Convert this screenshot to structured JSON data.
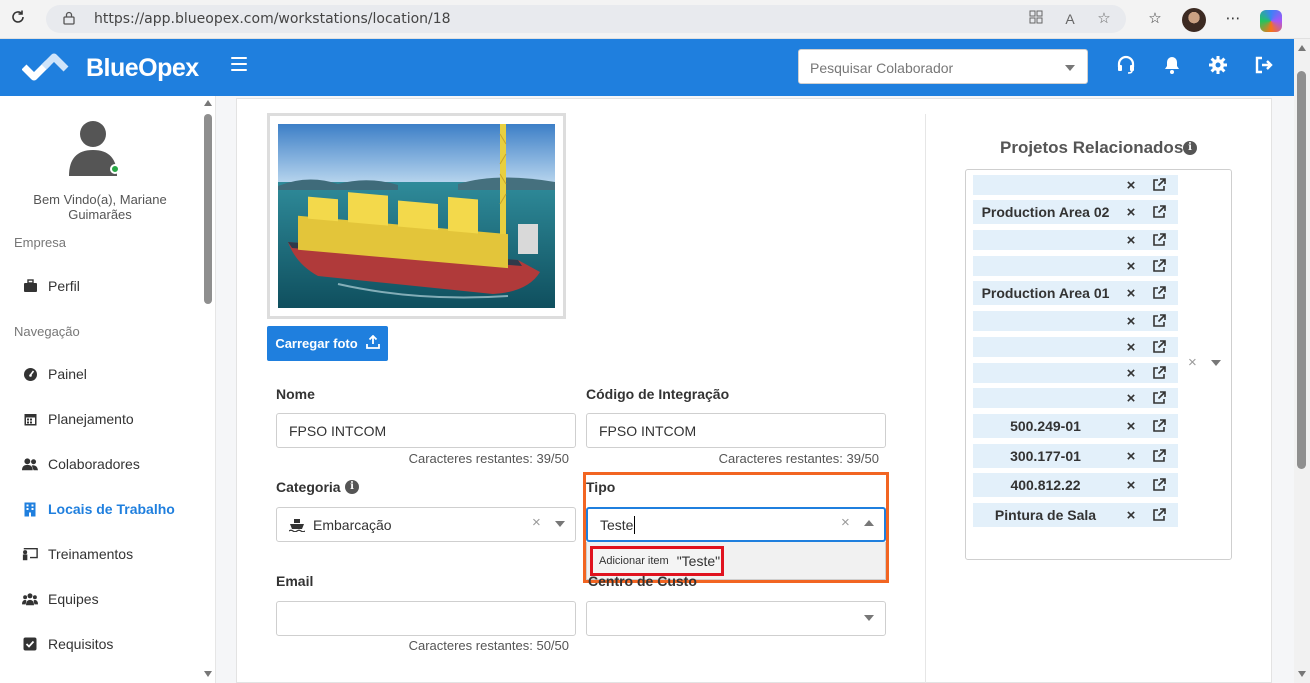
{
  "browser": {
    "url": "https://app.blueopex.com/workstations/location/18"
  },
  "app": {
    "brand": "BlueOpex",
    "search_placeholder": "Pesquisar Colaborador"
  },
  "sidebar": {
    "welcome": "Bem Vindo(a), Mariane Guimarães",
    "section_company": "Empresa",
    "section_nav": "Navegação",
    "items": [
      {
        "label": "Perfil",
        "icon": "briefcase-icon"
      },
      {
        "label": "Painel",
        "icon": "gauge-icon"
      },
      {
        "label": "Planejamento",
        "icon": "calendar-icon"
      },
      {
        "label": "Colaboradores",
        "icon": "users-icon"
      },
      {
        "label": "Locais de Trabalho",
        "icon": "building-icon",
        "active": true
      },
      {
        "label": "Treinamentos",
        "icon": "chalkboard-icon"
      },
      {
        "label": "Equipes",
        "icon": "group-icon"
      },
      {
        "label": "Requisitos",
        "icon": "checkbox-icon"
      }
    ]
  },
  "form": {
    "upload_label": "Carregar foto",
    "nome_label": "Nome",
    "nome_value": "FPSO INTCOM",
    "nome_hint": "Caracteres restantes: 39/50",
    "codigo_label": "Código de Integração",
    "codigo_value": "FPSO INTCOM",
    "codigo_hint": "Caracteres restantes: 39/50",
    "categoria_label": "Categoria",
    "categoria_value": "Embarcação",
    "tipo_label": "Tipo",
    "tipo_value": "Teste",
    "tipo_add_small": "Adicionar item",
    "tipo_add_value": "\"Teste\"",
    "email_label": "Email",
    "email_value": "",
    "email_hint": "Caracteres restantes: 50/50",
    "centro_label": "Centro de Custo",
    "centro_value": ""
  },
  "projects": {
    "title": "Projetos Relacionados",
    "items": [
      "",
      "Production Area 02",
      "",
      "",
      "Production Area 01",
      "",
      "",
      "",
      "",
      "500.249-01",
      "300.177-01",
      "400.812.22",
      "Pintura de Sala"
    ]
  },
  "colors": {
    "primary": "#1f7fde",
    "highlight_orange": "#f26522",
    "highlight_red": "#e0131f",
    "tag_bg": "#e3f0fa"
  }
}
